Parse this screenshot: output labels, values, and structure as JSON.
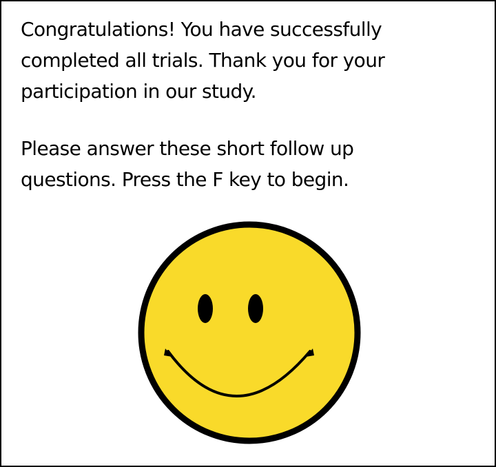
{
  "message": {
    "paragraph1": [
      "Congratulations! You have successfully",
      "completed all trials. Thank you for your",
      "participation in our study."
    ],
    "paragraph2": [
      "Please answer these short follow up",
      "questions. Press the F key to begin."
    ]
  },
  "smiley": {
    "icon": "smiley-face-icon",
    "face_color": "#F9DA2A",
    "outline_color": "#000000"
  },
  "colors": {
    "background": "#FFFFFF",
    "border": "#000000",
    "text": "#000000"
  }
}
